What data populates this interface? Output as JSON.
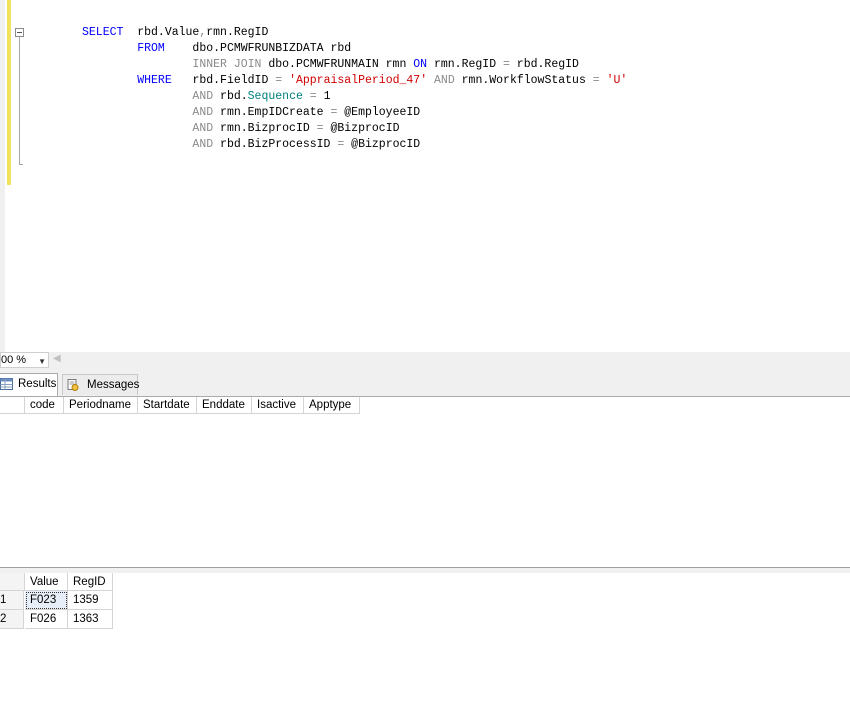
{
  "editor": {
    "lines": [
      [
        [
          "kw",
          "SELECT"
        ],
        [
          "tx",
          "  rbd.Value"
        ],
        [
          "gr",
          ","
        ],
        [
          "tx",
          "rmn.RegID"
        ]
      ],
      [
        [
          "tx",
          "        "
        ],
        [
          "kw",
          "FROM"
        ],
        [
          "tx",
          "    dbo.PCMWFRUNBIZDATA rbd"
        ]
      ],
      [
        [
          "tx",
          "                "
        ],
        [
          "gr",
          "INNER JOIN"
        ],
        [
          "tx",
          " dbo.PCMWFRUNMAIN rmn "
        ],
        [
          "kw",
          "ON"
        ],
        [
          "tx",
          " rmn.RegID "
        ],
        [
          "gr",
          "="
        ],
        [
          "tx",
          " rbd.RegID"
        ]
      ],
      [
        [
          "tx",
          "        "
        ],
        [
          "kw",
          "WHERE"
        ],
        [
          "tx",
          "   rbd.FieldID "
        ],
        [
          "gr",
          "="
        ],
        [
          "tx",
          " "
        ],
        [
          "str",
          "'AppraisalPeriod_47'"
        ],
        [
          "tx",
          " "
        ],
        [
          "gr",
          "AND"
        ],
        [
          "tx",
          " rmn.WorkflowStatus "
        ],
        [
          "gr",
          "="
        ],
        [
          "tx",
          " "
        ],
        [
          "str",
          "'U'"
        ]
      ],
      [
        [
          "tx",
          "                "
        ],
        [
          "gr",
          "AND"
        ],
        [
          "tx",
          " rbd."
        ],
        [
          "tl",
          "Sequence"
        ],
        [
          "tx",
          " "
        ],
        [
          "gr",
          "="
        ],
        [
          "tx",
          " 1"
        ]
      ],
      [
        [
          "tx",
          "                "
        ],
        [
          "gr",
          "AND"
        ],
        [
          "tx",
          " rmn.EmpIDCreate "
        ],
        [
          "gr",
          "="
        ],
        [
          "tx",
          " @EmployeeID"
        ]
      ],
      [
        [
          "tx",
          "                "
        ],
        [
          "gr",
          "AND"
        ],
        [
          "tx",
          " rmn.BizprocID "
        ],
        [
          "gr",
          "="
        ],
        [
          "tx",
          " @BizprocID"
        ]
      ],
      [
        [
          "tx",
          "                "
        ],
        [
          "gr",
          "AND"
        ],
        [
          "tx",
          " rbd.BizProcessID "
        ],
        [
          "gr",
          "="
        ],
        [
          "tx",
          " @BizprocID"
        ]
      ]
    ]
  },
  "zoom": {
    "value": "00 %"
  },
  "tabs": {
    "results": "Results",
    "messages": "Messages"
  },
  "grid1": {
    "columns": [
      "code",
      "Periodname",
      "Startdate",
      "Enddate",
      "Isactive",
      "Apptype"
    ]
  },
  "grid2": {
    "columns": [
      "Value",
      "RegID"
    ],
    "rows": [
      {
        "num": "1",
        "Value": "F023",
        "RegID": "1359"
      },
      {
        "num": "2",
        "Value": "F026",
        "RegID": "1363"
      }
    ]
  }
}
